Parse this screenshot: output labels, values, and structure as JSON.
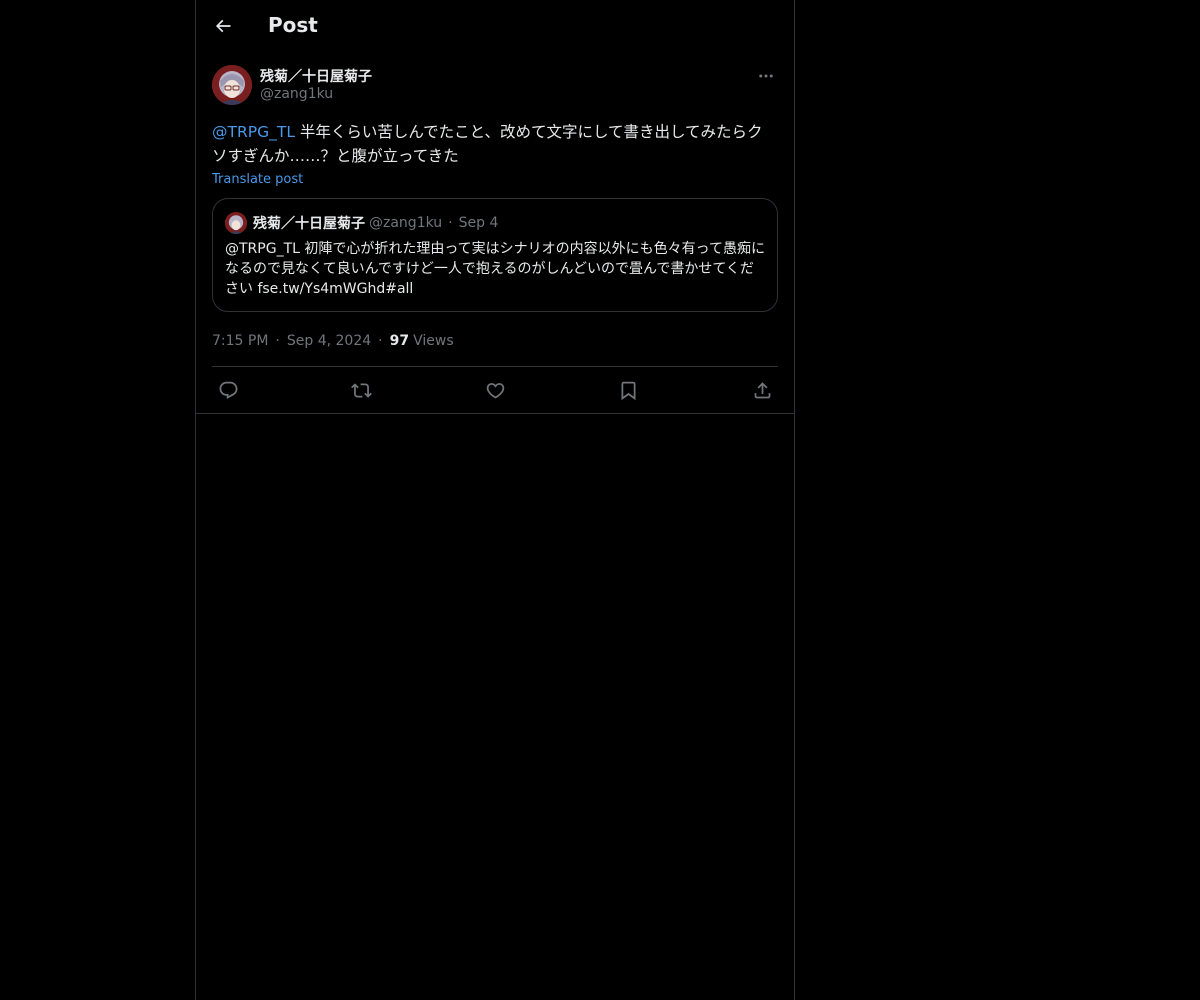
{
  "header": {
    "title": "Post",
    "back_icon": "arrow-left-icon"
  },
  "post": {
    "author_name": "残菊／十日屋菊子",
    "author_handle": "@zang1ku",
    "mention": "@TRPG_TL",
    "text": " 半年くらい苦しんでたこと、改めて文字にして書き出してみたらクソすぎんか……？と腹が立ってきた",
    "translate_label": "Translate post",
    "time": "7:15 PM",
    "date": "Sep 4, 2024",
    "views_count": "97",
    "views_label": "Views"
  },
  "quote": {
    "author_name": "残菊／十日屋菊子",
    "author_handle": "@zang1ku",
    "date": "Sep 4",
    "text": "@TRPG_TL 初陣で心が折れた理由って実はシナリオの内容以外にも色々有って愚痴になるので見なくて良いんですけど一人で抱えるのがしんどいので畳んで書かせてください fse.tw/Ys4mWGhd#all"
  },
  "actions": [
    "reply-icon",
    "repost-icon",
    "like-icon",
    "bookmark-icon",
    "share-icon"
  ],
  "colors": {
    "background": "#000000",
    "text": "#e7e9ea",
    "muted": "#71767b",
    "link": "#4a99e9",
    "border": "#2f3336"
  }
}
